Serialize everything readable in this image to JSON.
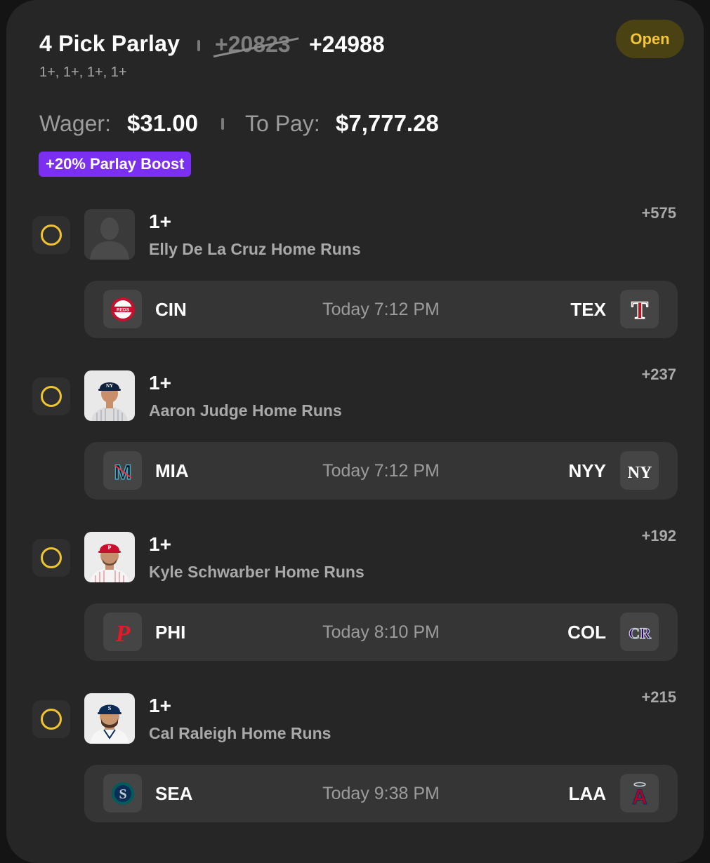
{
  "header": {
    "title": "4 Pick Parlay",
    "original_odds": "+20823",
    "boosted_odds": "+24988",
    "lines_summary": "1+, 1+, 1+, 1+",
    "status": "Open"
  },
  "wager": {
    "wager_label": "Wager:",
    "wager_value": "$31.00",
    "pay_label": "To Pay:",
    "pay_value": "$7,777.28",
    "boost": "+20% Parlay Boost"
  },
  "legs": [
    {
      "line": "1+",
      "prop": "Elly De La Cruz Home Runs",
      "price": "+575",
      "away": "CIN",
      "home": "TEX",
      "time": "Today 7:12 PM",
      "avatar": "placeholder-silhouette-icon",
      "away_logo": "reds-logo-icon",
      "home_logo": "rangers-logo-icon"
    },
    {
      "line": "1+",
      "prop": "Aaron Judge Home Runs",
      "price": "+237",
      "away": "MIA",
      "home": "NYY",
      "time": "Today 7:12 PM",
      "avatar": "player-photo-icon",
      "away_logo": "marlins-logo-icon",
      "home_logo": "yankees-logo-icon"
    },
    {
      "line": "1+",
      "prop": "Kyle Schwarber Home Runs",
      "price": "+192",
      "away": "PHI",
      "home": "COL",
      "time": "Today 8:10 PM",
      "avatar": "player-photo-icon",
      "away_logo": "phillies-logo-icon",
      "home_logo": "rockies-logo-icon"
    },
    {
      "line": "1+",
      "prop": "Cal Raleigh Home Runs",
      "price": "+215",
      "away": "SEA",
      "home": "LAA",
      "time": "Today 9:38 PM",
      "avatar": "player-photo-icon",
      "away_logo": "mariners-logo-icon",
      "home_logo": "angels-logo-icon"
    }
  ],
  "colors": {
    "background": "#141414",
    "card": "#262626",
    "game_row": "#353535",
    "status_bg": "#4a4213",
    "status_text": "#f2c53d",
    "boost_bg": "#7a2ff2",
    "pending_ring": "#f0c430"
  },
  "logos": {
    "reds_text": "REDS",
    "rangers_text": "T",
    "marlins_text": "M",
    "yankees_text": "NY",
    "phillies_text": "P",
    "rockies_text": "CR",
    "mariners_text": "S",
    "angels_text": "A"
  }
}
